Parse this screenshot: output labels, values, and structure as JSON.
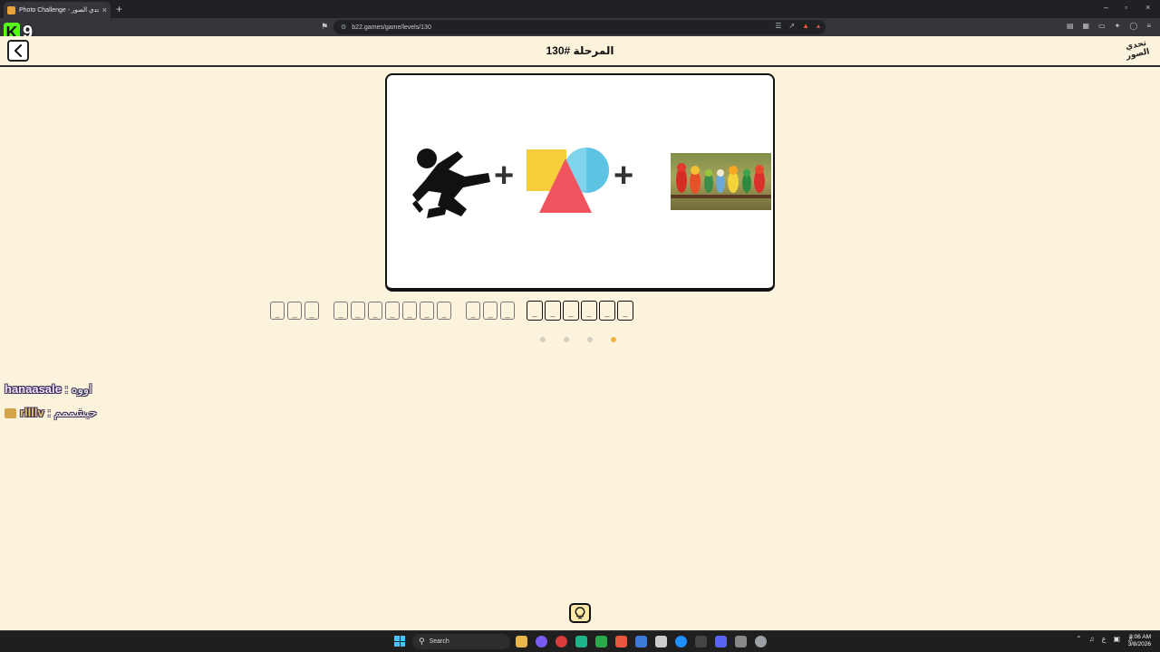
{
  "browser": {
    "tab_title": "Photo Challenge - تحدي الصور",
    "tab_close_glyph": "×",
    "new_tab_glyph": "+",
    "url": "b22.games/game/levels/130",
    "window_controls": [
      "–",
      "▫",
      "×"
    ]
  },
  "stream_overlay": {
    "logo_letter": "K",
    "logo_number": "9"
  },
  "header": {
    "back_glyph": "‹",
    "title": "المرحلة #130",
    "brand_logo_text": "تحدي الصور"
  },
  "puzzle": {
    "operators": [
      "+",
      "+"
    ],
    "pictures": [
      "person-slipping-icon",
      "colorful-shapes-icon",
      "parrots-photo"
    ]
  },
  "answer": {
    "slot_glyph": "_",
    "word_lengths": [
      3,
      7,
      3,
      6
    ]
  },
  "progress": {
    "total": 4,
    "current_index": 3
  },
  "chat": [
    {
      "user": "hanaasale",
      "separator": " : ",
      "message": "اووه"
    },
    {
      "user": "rllllv",
      "separator": " : ",
      "message": "حيشممم",
      "badge": true
    }
  ],
  "taskbar": {
    "search_label": "Search",
    "tray_lang": "ع",
    "clock_time": "8:06 AM",
    "clock_date": "3/8/2026"
  },
  "colors": {
    "page_bg": "#fbf3dc",
    "accent_dot": "#f1b23e",
    "kick_green": "#53fc18"
  }
}
